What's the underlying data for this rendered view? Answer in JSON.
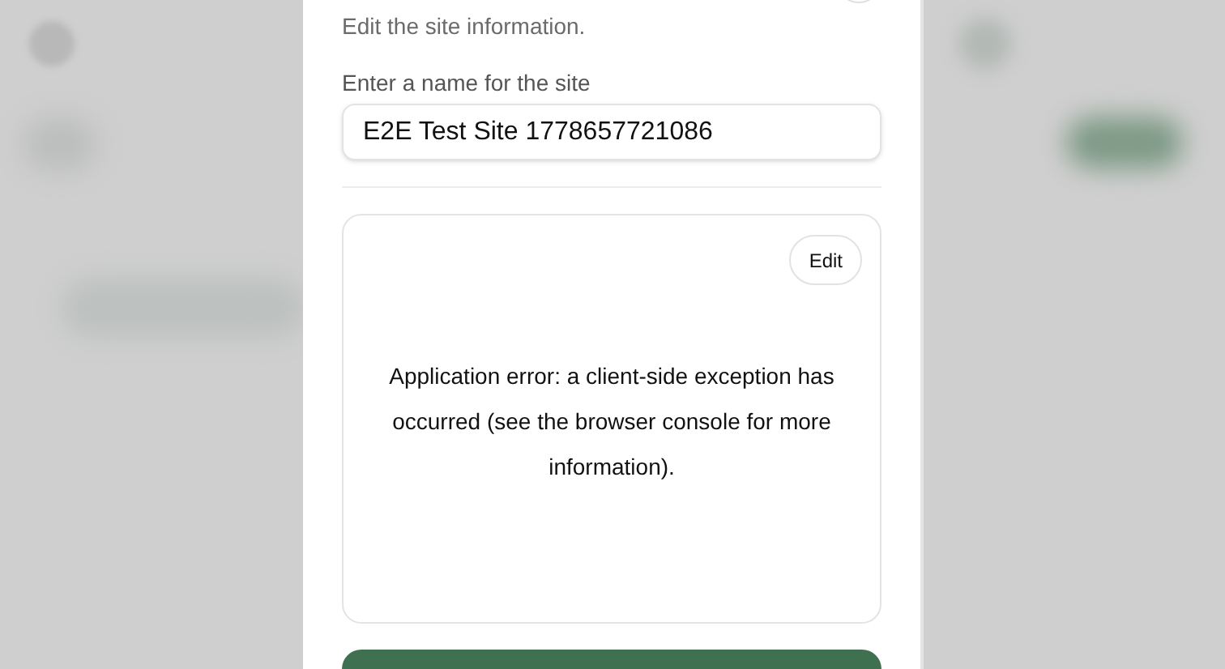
{
  "dialog": {
    "description": "Edit the site information.",
    "name_field": {
      "label": "Enter a name for the site",
      "value": "E2E Test Site 1778657721086"
    },
    "preview": {
      "edit_button": "Edit",
      "error_message": "Application error: a client-side exception has occurred (see the browser console for more information)."
    }
  }
}
